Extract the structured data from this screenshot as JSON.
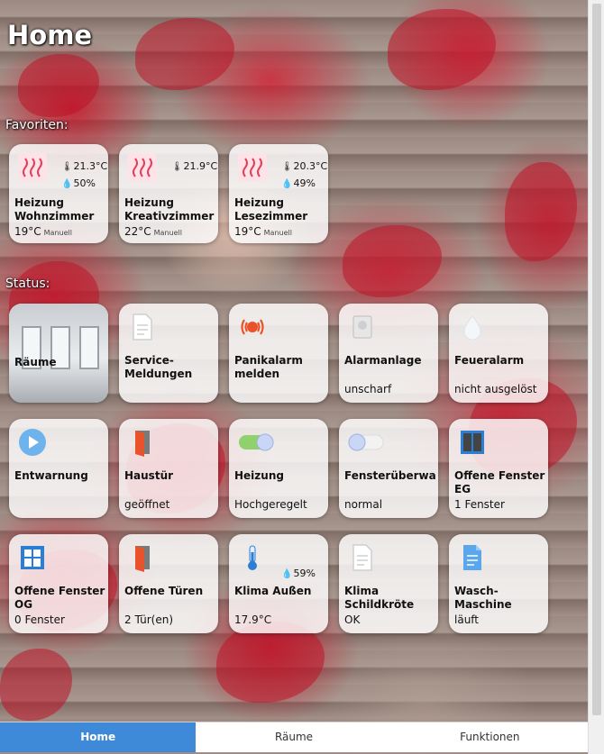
{
  "page": {
    "title": "Home"
  },
  "sections": {
    "favorites": "Favoriten:",
    "status": "Status:"
  },
  "favorites": [
    {
      "icon": "heating-icon",
      "temp": "21.3°C",
      "humidity": "50%",
      "name": "Heizung Wohnzimmer",
      "setpoint": "19°C",
      "mode": "Manuell"
    },
    {
      "icon": "heating-icon",
      "temp": "21.9°C",
      "humidity": "",
      "name": "Heizung Kreativzimmer",
      "setpoint": "22°C",
      "mode": "Manuell"
    },
    {
      "icon": "heating-icon",
      "temp": "20.3°C",
      "humidity": "49%",
      "name": "Heizung Lesezimmer",
      "setpoint": "19°C",
      "mode": "Manuell"
    }
  ],
  "status_tiles": [
    {
      "name": "Räume",
      "status": "",
      "icon": "rooms-image"
    },
    {
      "name": "Service-Meldungen",
      "status": "",
      "icon": "document-icon"
    },
    {
      "name": "Panikalarm melden",
      "status": "",
      "icon": "panic-alarm-icon"
    },
    {
      "name": "Alarmanlage",
      "status": "unscharf",
      "icon": "alarm-system-icon"
    },
    {
      "name": "Feueralarm",
      "status": "nicht ausgelöst",
      "icon": "fire-drop-icon"
    },
    {
      "name": "Entwarnung",
      "status": "",
      "icon": "play-icon"
    },
    {
      "name": "Haustür",
      "status": "geöffnet",
      "icon": "door-open-icon"
    },
    {
      "name": "Heizung",
      "status": "Hochgeregelt",
      "icon": "toggle-on-icon"
    },
    {
      "name": "Fensterüberwa",
      "status": "normal",
      "icon": "toggle-off-icon"
    },
    {
      "name": "Offene Fenster EG",
      "status": "1 Fenster",
      "icon": "window-open-icon"
    },
    {
      "name": "Offene Fenster OG",
      "status": "0 Fenster",
      "icon": "window-closed-icon"
    },
    {
      "name": "Offene Türen",
      "status": "2 Tür(en)",
      "icon": "door-open-icon"
    },
    {
      "name": "Klima Außen",
      "status": "17.9°C",
      "humidity": "59%",
      "icon": "thermometer-icon"
    },
    {
      "name": "Klima Schildkröte",
      "status": "OK",
      "icon": "document-icon"
    },
    {
      "name": "Wasch-Maschine",
      "status": "läuft",
      "icon": "document-blue-icon"
    }
  ],
  "tabs": [
    {
      "label": "Home",
      "active": true
    },
    {
      "label": "Räume",
      "active": false
    },
    {
      "label": "Funktionen",
      "active": false
    }
  ],
  "colors": {
    "accent": "#3f8ad8",
    "heating": "#e0405a",
    "door": "#e8532b",
    "window": "#2a7fd4"
  }
}
